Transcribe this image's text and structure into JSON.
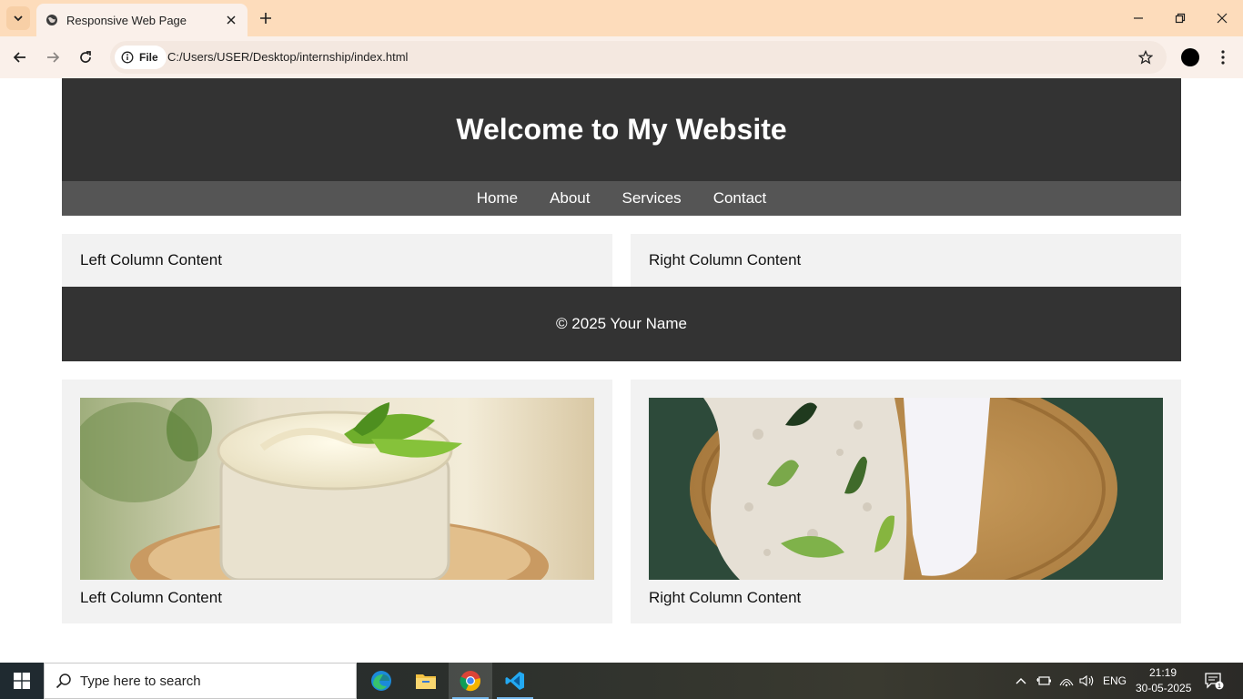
{
  "browser": {
    "tab_title": "Responsive Web Page",
    "site_chip_label": "File",
    "url": "C:/Users/USER/Desktop/internship/index.html"
  },
  "page": {
    "header_title": "Welcome to My Website",
    "nav": [
      "Home",
      "About",
      "Services",
      "Contact"
    ],
    "row1": {
      "left": "Left Column Content",
      "right": "Right Column Content"
    },
    "footer": "© 2025 Your Name",
    "row2": {
      "left_caption": "Left Column Content",
      "right_caption": "Right Column Content",
      "left_image": "cream-jar-with-leaves-photo",
      "right_image": "foam-on-wooden-tray-with-leaves-photo"
    },
    "colors": {
      "header_bg": "#333333",
      "nav_bg": "#555555",
      "column_bg": "#f2f2f2",
      "footer_bg": "#333333"
    }
  },
  "taskbar": {
    "search_placeholder": "Type here to search",
    "language": "ENG",
    "time": "21:19",
    "date": "30-05-2025",
    "notification_count": "1",
    "apps": [
      "edge-icon",
      "file-explorer-icon",
      "chrome-icon",
      "vscode-icon"
    ]
  }
}
